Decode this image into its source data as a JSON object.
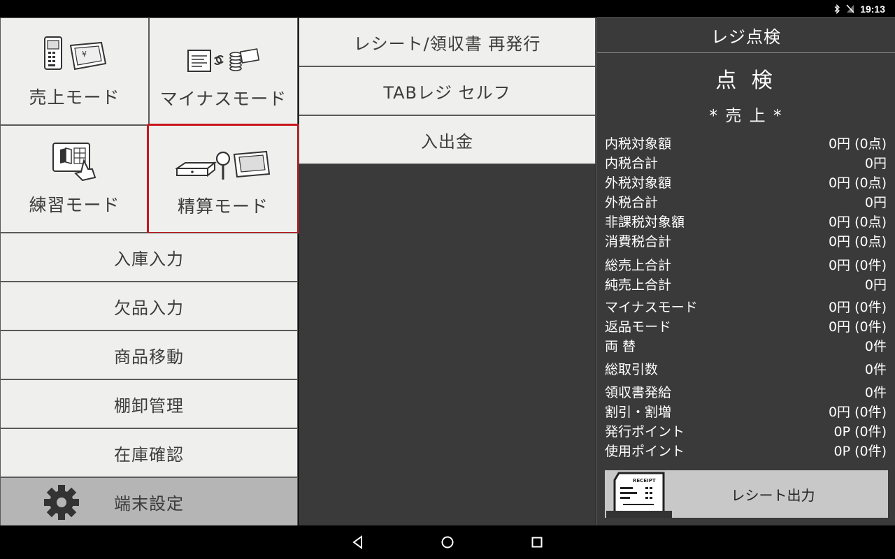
{
  "status_bar": {
    "time": "19:13",
    "icons": [
      "bluetooth-icon",
      "no-signal-icon"
    ]
  },
  "tiles": {
    "sales_mode": "売上モード",
    "minus_mode": "マイナスモード",
    "practice_mode": "練習モード",
    "settlement_mode": "精算モード"
  },
  "left_menu": {
    "stock_in": "入庫入力",
    "shortage": "欠品入力",
    "item_transfer": "商品移動",
    "inventory": "棚卸管理",
    "stock_check": "在庫確認",
    "terminal_settings": "端末設定"
  },
  "middle_menu": {
    "reissue": "レシート/領収書 再発行",
    "tab_self": "TABレジ セルフ",
    "cash_in_out": "入出金"
  },
  "panel": {
    "header": "レジ点検",
    "title": "点 検",
    "subtitle": "* 売 上 *",
    "rows": [
      {
        "label": "内税対象額",
        "value": "0円 (0点)"
      },
      {
        "label": "内税合計",
        "value": "0円"
      },
      {
        "label": "外税対象額",
        "value": "0円 (0点)"
      },
      {
        "label": "外税合計",
        "value": "0円"
      },
      {
        "label": "非課税対象額",
        "value": "0円 (0点)"
      },
      {
        "label": "消費税合計",
        "value": "0円 (0点)"
      },
      {
        "label": "総売上合計",
        "value": "0円 (0件)"
      },
      {
        "label": "純売上合計",
        "value": "0円"
      },
      {
        "label": "マイナスモード",
        "value": "0円 (0件)"
      },
      {
        "label": "返品モード",
        "value": "0円 (0件)"
      },
      {
        "label": "両 替",
        "value": "0件"
      },
      {
        "label": "総取引数",
        "value": "0件"
      },
      {
        "label": "領収書発給",
        "value": "0件"
      },
      {
        "label": "割引・割増",
        "value": "0円 (0件)"
      },
      {
        "label": "発行ポイント",
        "value": "0P (0件)"
      },
      {
        "label": "使用ポイント",
        "value": "0P (0件)"
      }
    ],
    "receipt_button": "レシート出力",
    "receipt_icon_text": "RECEIPT"
  },
  "colors": {
    "tile_bg": "#efefed",
    "panel_bg": "#3a3a3a",
    "selected_border": "#c8161d",
    "settings_bg": "#b5b5b5"
  }
}
